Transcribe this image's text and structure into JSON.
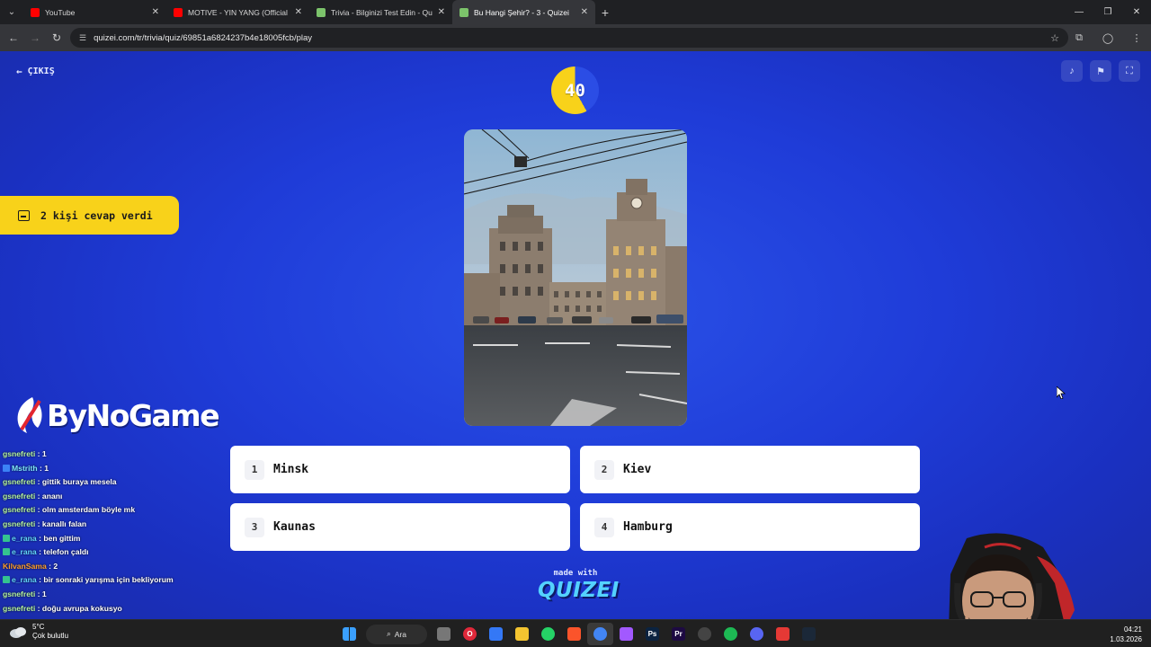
{
  "browser": {
    "tabs": [
      {
        "title": "YouTube",
        "favicon_color": "#ff0000",
        "active": false
      },
      {
        "title": "MOTIVE - YIN YANG (Official M",
        "favicon_color": "#ff0000",
        "active": false
      },
      {
        "title": "Trivia - Bilginizi Test Edin - Qui",
        "favicon_color": "#7cc36b",
        "active": false
      },
      {
        "title": "Bu Hangi Şehir? - 3 - Quizei",
        "favicon_color": "#7cc36b",
        "active": true
      }
    ],
    "url": "quizei.com/tr/trivia/quiz/69851a6824237b4e18005fcb/play"
  },
  "quiz": {
    "exit_label": "ÇIKIŞ",
    "timer": "40",
    "timer_remaining_fraction": 0.58,
    "answered_text": "2 kişi cevap verdi",
    "answers": [
      {
        "num": "1",
        "text": "Minsk"
      },
      {
        "num": "2",
        "text": "Kiev"
      },
      {
        "num": "3",
        "text": "Kaunas"
      },
      {
        "num": "4",
        "text": "Hamburg"
      }
    ],
    "made_with": "made with",
    "brand": "QUIZEI",
    "accent_color": "#f8d21a",
    "background_color": "#1f3cd8"
  },
  "overlay": {
    "logo_text": "ByNoGame",
    "chat": [
      {
        "user": "gsnefreti",
        "color": "#b6f5a0",
        "message": " : 1",
        "badge": ""
      },
      {
        "user": "Mstrith",
        "color": "#7fe8ff",
        "message": " : 1",
        "badge": "#3b82f6"
      },
      {
        "user": "gsnefreti",
        "color": "#b6f5a0",
        "message": " : gittik buraya mesela",
        "badge": ""
      },
      {
        "user": "gsnefreti",
        "color": "#b6f5a0",
        "message": " : ananı",
        "badge": ""
      },
      {
        "user": "gsnefreti",
        "color": "#b6f5a0",
        "message": " : olm amsterdam böyle mk",
        "badge": ""
      },
      {
        "user": "gsnefreti",
        "color": "#b6f5a0",
        "message": " : kanallı falan",
        "badge": ""
      },
      {
        "user": "e_rana",
        "color": "#63d6ff",
        "message": " : ben gittim",
        "badge": "#34c38f"
      },
      {
        "user": "e_rana",
        "color": "#63d6ff",
        "message": " : telefon çaldı",
        "badge": "#34c38f"
      },
      {
        "user": "KilvanSama",
        "color": "#ff9f2e",
        "message": " : 2",
        "badge": ""
      },
      {
        "user": "e_rana",
        "color": "#63d6ff",
        "message": " : bir sonraki yarışma için bekliyorum",
        "badge": "#34c38f"
      },
      {
        "user": "gsnefreti",
        "color": "#b6f5a0",
        "message": " : 1",
        "badge": ""
      },
      {
        "user": "gsnefreti",
        "color": "#b6f5a0",
        "message": " : doğu avrupa kokusyo",
        "badge": ""
      }
    ]
  },
  "taskbar": {
    "weather_temp": "5°C",
    "weather_desc": "Çok bulutlu",
    "search_label": "Ara",
    "time": "04:21",
    "date": "1.03.2026",
    "apps": [
      {
        "name": "windows-start-icon",
        "color": "#3aa0ff",
        "label": ""
      },
      {
        "name": "file-manager-icon",
        "color": "#777777",
        "label": ""
      },
      {
        "name": "opera-icon",
        "color": "#e0283a",
        "label": "O"
      },
      {
        "name": "store-icon",
        "color": "#3478f6",
        "label": ""
      },
      {
        "name": "folder-icon",
        "color": "#f4c430",
        "label": ""
      },
      {
        "name": "whatsapp-icon",
        "color": "#25d366",
        "label": ""
      },
      {
        "name": "brave-icon",
        "color": "#fb542b",
        "label": ""
      },
      {
        "name": "chrome-icon",
        "color": "#4285f4",
        "label": ""
      },
      {
        "name": "figma-icon",
        "color": "#a259ff",
        "label": ""
      },
      {
        "name": "photoshop-icon",
        "color": "#0b2340",
        "label": "Ps"
      },
      {
        "name": "premiere-icon",
        "color": "#1d0a42",
        "label": "Pr"
      },
      {
        "name": "obs-icon",
        "color": "#444444",
        "label": ""
      },
      {
        "name": "spotify-icon",
        "color": "#1db954",
        "label": ""
      },
      {
        "name": "discord-icon",
        "color": "#5865f2",
        "label": ""
      },
      {
        "name": "bolt-icon",
        "color": "#e53935",
        "label": ""
      },
      {
        "name": "steam-icon",
        "color": "#1b2838",
        "label": ""
      }
    ]
  }
}
